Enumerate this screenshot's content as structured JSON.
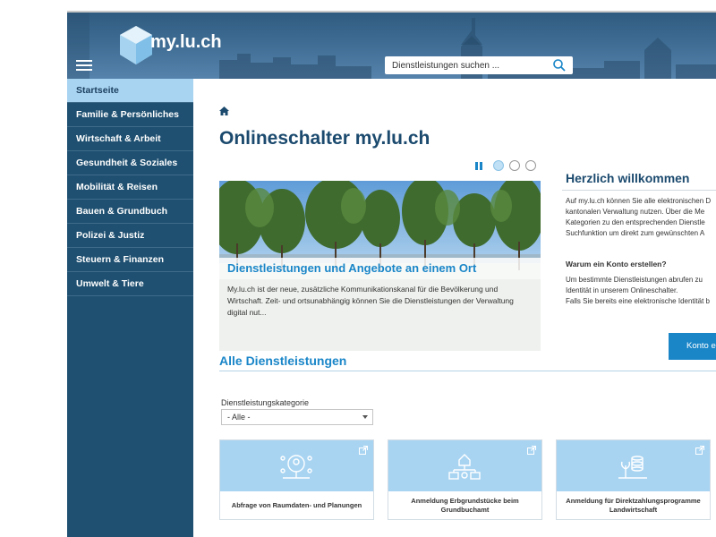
{
  "header": {
    "logo_text": "my.lu.ch",
    "search_placeholder": "Dienstleistungen suchen ..."
  },
  "sidebar": {
    "items": [
      {
        "label": "Startseite",
        "active": true
      },
      {
        "label": "Familie & Persönliches"
      },
      {
        "label": "Wirtschaft & Arbeit"
      },
      {
        "label": "Gesundheit & Soziales"
      },
      {
        "label": "Mobilität & Reisen"
      },
      {
        "label": "Bauen & Grundbuch"
      },
      {
        "label": "Polizei & Justiz"
      },
      {
        "label": "Steuern & Finanzen"
      },
      {
        "label": "Umwelt & Tiere"
      }
    ]
  },
  "main": {
    "title": "Onlineschalter my.lu.ch",
    "slider": {
      "slide_count": 3,
      "active_index": 0,
      "heading": "Dienstleistungen und Angebote an einem Ort",
      "text": "My.lu.ch ist der neue, zusätzliche Kommunikationskanal für die Bevölkerung und Wirtschaft. Zeit- und ortsunabhängig können Sie die Dienstleistungen der Verwaltung digital nut..."
    },
    "welcome": {
      "title": "Herzlich willkommen",
      "lines": [
        "Auf my.lu.ch können Sie alle elektronischen D",
        "kantonalen Verwaltung nutzen. Über die Me",
        "Kategorien zu den entsprechenden Dienstle",
        "Suchfunktion um direkt zum gewünschten A"
      ],
      "account_heading": "Warum ein Konto erstellen?",
      "account_lines": [
        "Um bestimmte Dienstleistungen abrufen zu",
        "Identität in unserem Onlineschalter.",
        "Falls Sie bereits eine elektronische Identität b"
      ],
      "account_button": "Konto e"
    },
    "services": {
      "title": "Alle Dienstleistungen",
      "filter_label": "Dienstleistungskategorie",
      "filter_value": "- Alle -",
      "cards": [
        {
          "label": "Abfrage von Raumdaten- und Planungen",
          "icon": "map-pin-icon"
        },
        {
          "label": "Anmeldung Erbgrundstücke beim Grundbuchamt",
          "icon": "property-network-icon"
        },
        {
          "label": "Anmeldung für Direktzahlungsprogramme Landwirtschaft",
          "icon": "farm-money-icon"
        }
      ]
    }
  },
  "colors": {
    "primary": "#1a86c8",
    "dark_blue": "#1b4a6e",
    "sidebar": "#1f5071",
    "active_nav": "#a8d4f2",
    "card_top": "#a8d4f2"
  }
}
